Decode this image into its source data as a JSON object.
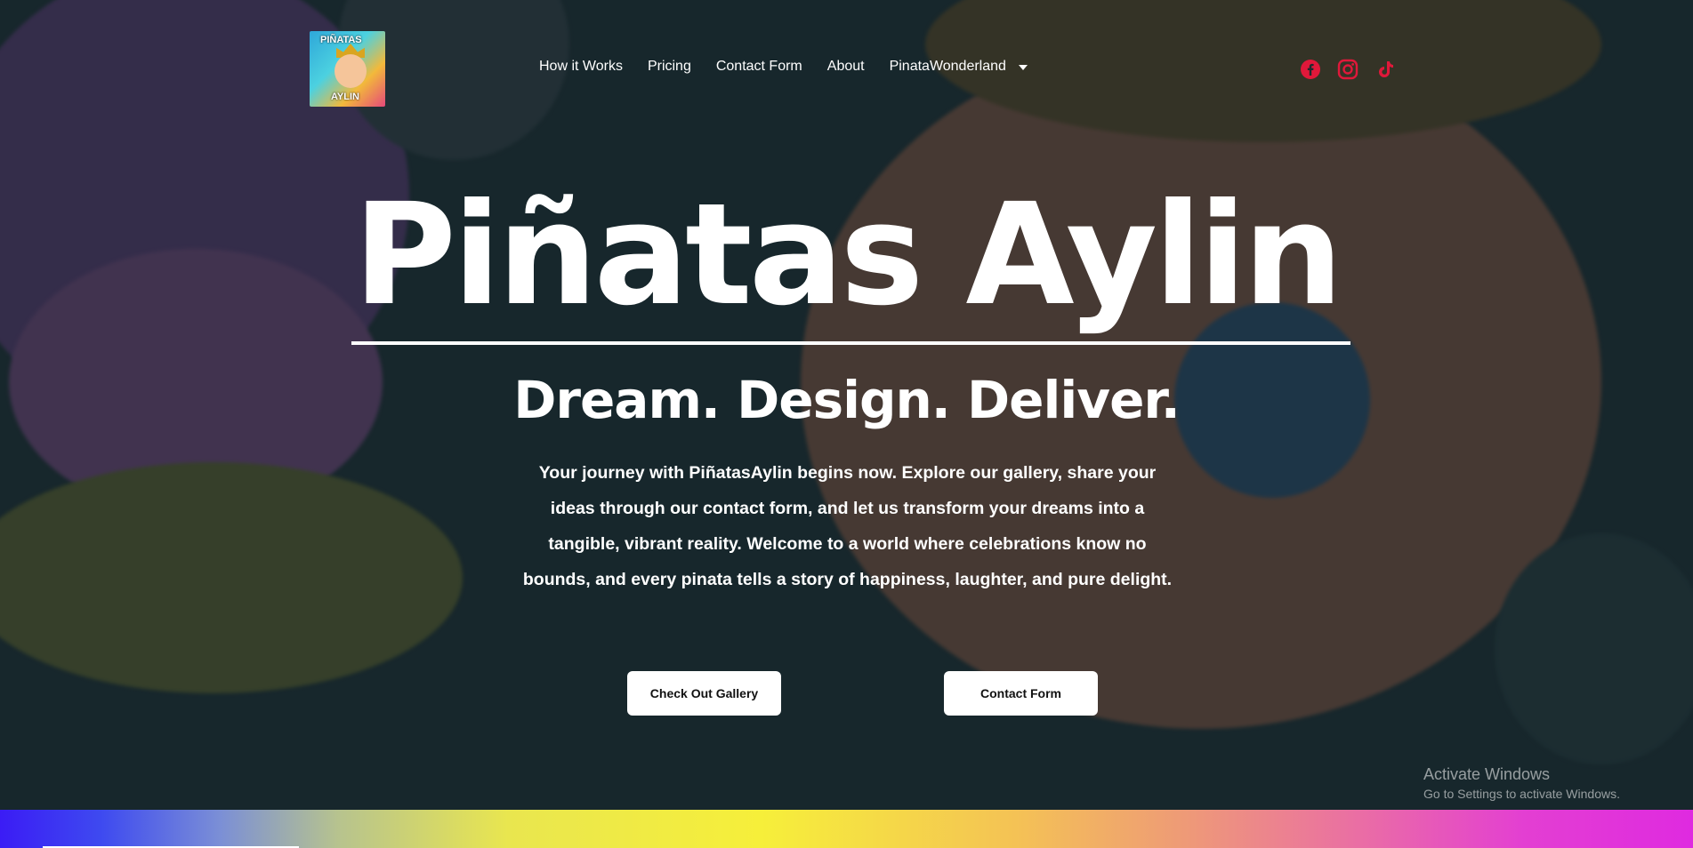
{
  "brand": {
    "logo_line1": "PIÑATAS",
    "logo_line2": "AYLIN"
  },
  "nav": {
    "items": [
      "How it Works",
      "Pricing",
      "Contact Form",
      "About",
      "PinataWonderland"
    ]
  },
  "social": {
    "icons": [
      "facebook-icon",
      "instagram-icon",
      "tiktok-icon"
    ],
    "color": "#e0183a"
  },
  "hero": {
    "title": "Piñatas Aylin",
    "tagline": "Dream. Design. Deliver.",
    "description": "Your journey with PiñatasAylin begins now. Explore our gallery, share your ideas through our contact form, and let us transform your dreams into a tangible, vibrant reality. Welcome to a world where celebrations know no bounds, and every pinata tells a story of happiness, laughter, and pure delight."
  },
  "buttons": {
    "gallery": "Check Out Gallery",
    "contact": "Contact Form"
  },
  "watermark": {
    "line1": "Activate Windows",
    "line2": "Go to Settings to activate Windows."
  }
}
